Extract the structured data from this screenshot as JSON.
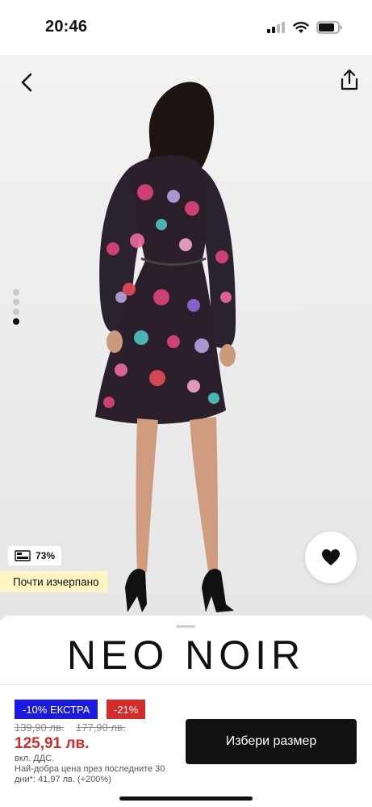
{
  "status_bar": {
    "time": "20:46"
  },
  "product": {
    "image_position": {
      "current": 4,
      "total": 4
    },
    "sustainability": {
      "icon": "leaf-tag-icon",
      "percent": "73%"
    },
    "stock_label": "Почти изчерпано"
  },
  "brand": {
    "name": "NEO NOIR"
  },
  "pricing": {
    "extra_badge": "-10% ЕКСТРА",
    "discount_badge": "-21%",
    "old_price_1": "139,90 лв.",
    "old_price_2": "177,90 лв.",
    "price": "125,91 лв.",
    "vat_note": "вкл. ДДС.",
    "best_price_note": "Най-добра цена през последните 30 дни*: 41,97 лв. (+200%)"
  },
  "actions": {
    "choose_size": "Избери размер"
  },
  "colors": {
    "accent_blue": "#1a1ae0",
    "sale_red": "#d42b2b",
    "stock_yellow": "#fff4c2"
  }
}
